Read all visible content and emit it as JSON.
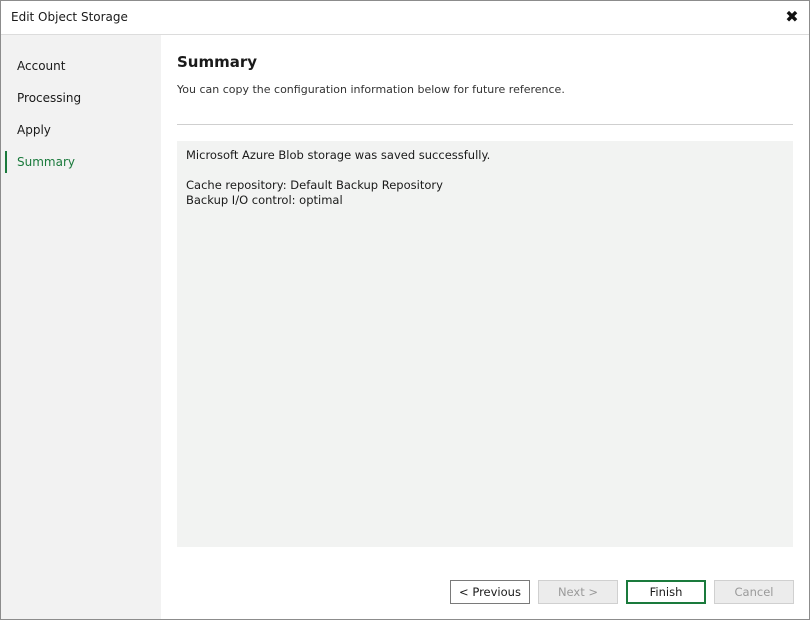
{
  "window": {
    "title": "Edit Object Storage",
    "close_glyph": "✖"
  },
  "sidebar": {
    "items": [
      {
        "label": "Account",
        "active": false
      },
      {
        "label": "Processing",
        "active": false
      },
      {
        "label": "Apply",
        "active": false
      },
      {
        "label": "Summary",
        "active": true
      }
    ]
  },
  "main": {
    "title": "Summary",
    "subtitle": "You can copy the configuration information below for future reference.",
    "summary_lines": [
      "Microsoft Azure Blob storage was saved successfully.",
      "",
      "Cache repository: Default Backup Repository",
      "Backup I/O control: optimal"
    ]
  },
  "buttons": {
    "previous": "< Previous",
    "next": "Next >",
    "finish": "Finish",
    "cancel": "Cancel"
  },
  "colors": {
    "accent": "#1a7a3c",
    "summary_background": "#f2f3f2",
    "sidebar_background": "#f2f2f2"
  }
}
